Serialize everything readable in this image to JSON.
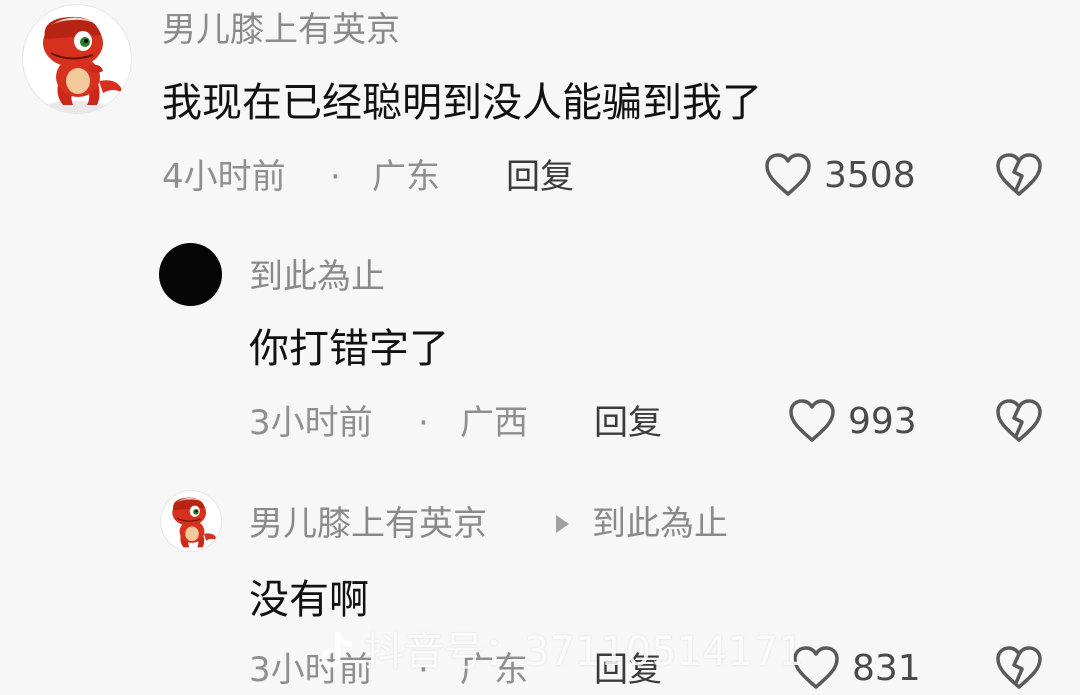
{
  "comments": [
    {
      "username": "男儿膝上有英京",
      "content": "我现在已经聪明到没人能骗到我了",
      "time": "4小时前",
      "separator": "·",
      "location": "广东",
      "reply_label": "回复",
      "likes": "3508"
    },
    {
      "username": "到此為止",
      "content": "你打错字了",
      "time": "3小时前",
      "separator": "·",
      "location": "广西",
      "reply_label": "回复",
      "likes": "993"
    },
    {
      "username": "男儿膝上有英京",
      "reply_to": "到此為止",
      "content": "没有啊",
      "time": "3小时前",
      "separator": "·",
      "location": "广东",
      "reply_label": "回复",
      "likes": "831"
    }
  ],
  "watermark": "抖音号：37110514171",
  "colors": {
    "background": "#f7f7f7",
    "username": "#8a8a8a",
    "content": "#111111",
    "meta": "#8f8f8f",
    "icon": "#5a5a5a",
    "dino_red": "#d6301f"
  },
  "icons": {
    "like": "heart-outline-icon",
    "dislike": "broken-heart-icon",
    "reply_arrow": "play-triangle-icon",
    "brand": "tiktok-logo-icon"
  }
}
